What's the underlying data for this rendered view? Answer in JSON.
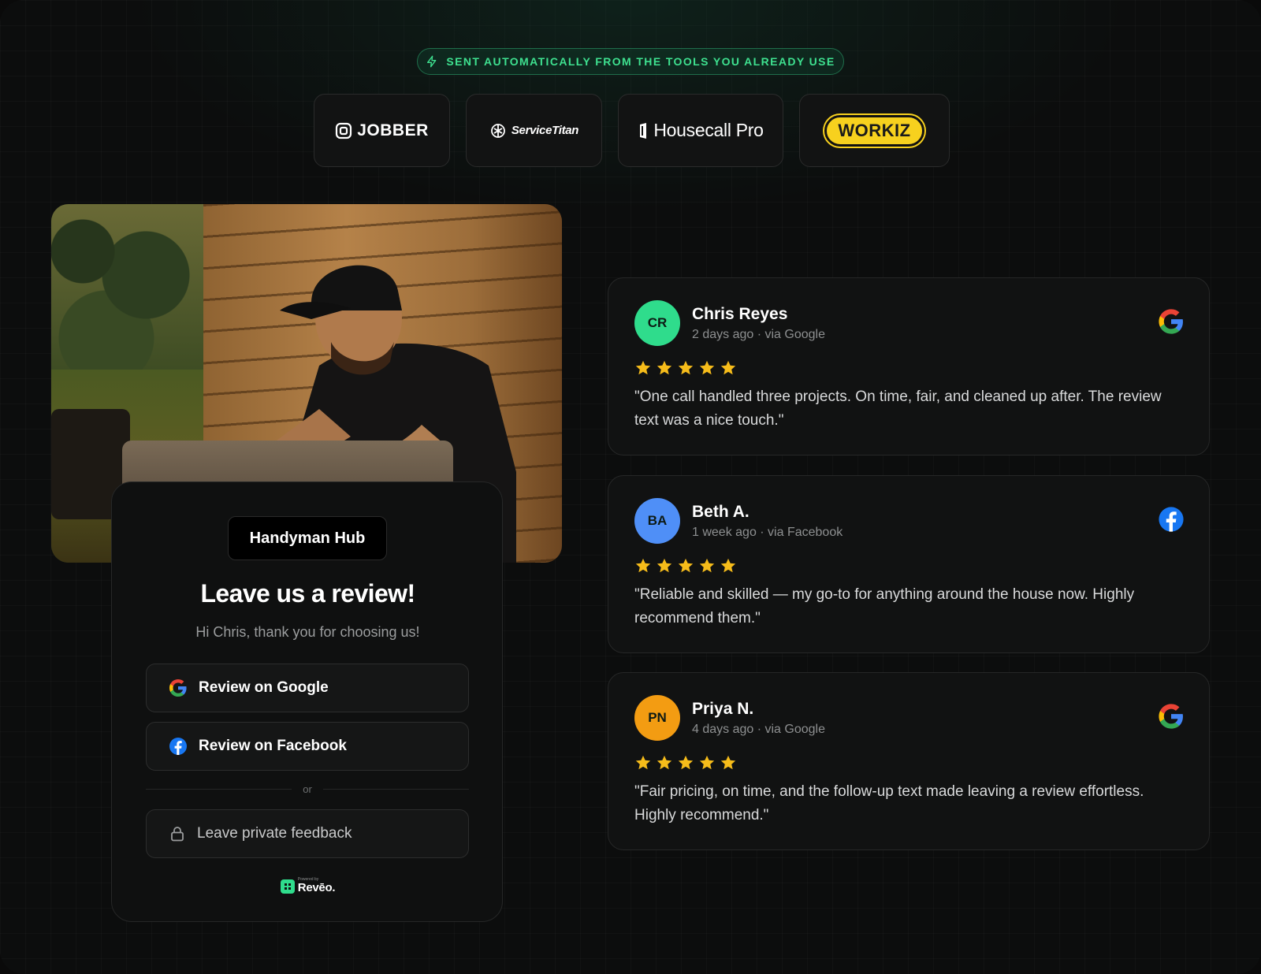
{
  "badge": {
    "icon": "lightning-icon",
    "text": "SENT AUTOMATICALLY FROM THE TOOLS YOU ALREADY USE"
  },
  "integrations": [
    {
      "name": "JOBBER",
      "icon": "jobber-logo-icon"
    },
    {
      "name": "ServiceTitan",
      "icon": "servicetitan-logo-icon"
    },
    {
      "name": "Housecall Pro",
      "icon": "housecall-logo-icon"
    },
    {
      "name": "WORKIZ",
      "icon": "workiz-logo-icon"
    }
  ],
  "request": {
    "business": "Handyman Hub",
    "title": "Leave us a review!",
    "subtitle": "Hi Chris, thank you for choosing us!",
    "google_button": "Review on Google",
    "facebook_button": "Review on Facebook",
    "divider": "or",
    "private_button": "Leave private feedback",
    "powered_small": "Powered by",
    "powered_brand": "Revēo."
  },
  "reviews": [
    {
      "initials": "CR",
      "name": "Chris Reyes",
      "meta": "2 days ago · via Google",
      "platform": "google",
      "rating": 5,
      "text": "\"One call handled three projects. On time, fair, and cleaned up after. The review text was a nice touch.\"",
      "avatar_color": "#2fdc8c"
    },
    {
      "initials": "BA",
      "name": "Beth A.",
      "meta": "1 week ago · via Facebook",
      "platform": "facebook",
      "rating": 5,
      "text": "\"Reliable and skilled — my go-to for anything around the house now. Highly recommend them.\"",
      "avatar_color": "#4f8ff7"
    },
    {
      "initials": "PN",
      "name": "Priya N.",
      "meta": "4 days ago · via Google",
      "platform": "google",
      "rating": 5,
      "text": "\"Fair pricing, on time, and the follow-up text made leaving a review effortless. Highly recommend.\"",
      "avatar_color": "#f39c12"
    }
  ],
  "colors": {
    "accent": "#3ee08f",
    "star": "#f6bc1a",
    "google_blue": "#4285F4",
    "facebook_blue": "#1877F2",
    "workiz_yellow": "#f7d11e"
  }
}
